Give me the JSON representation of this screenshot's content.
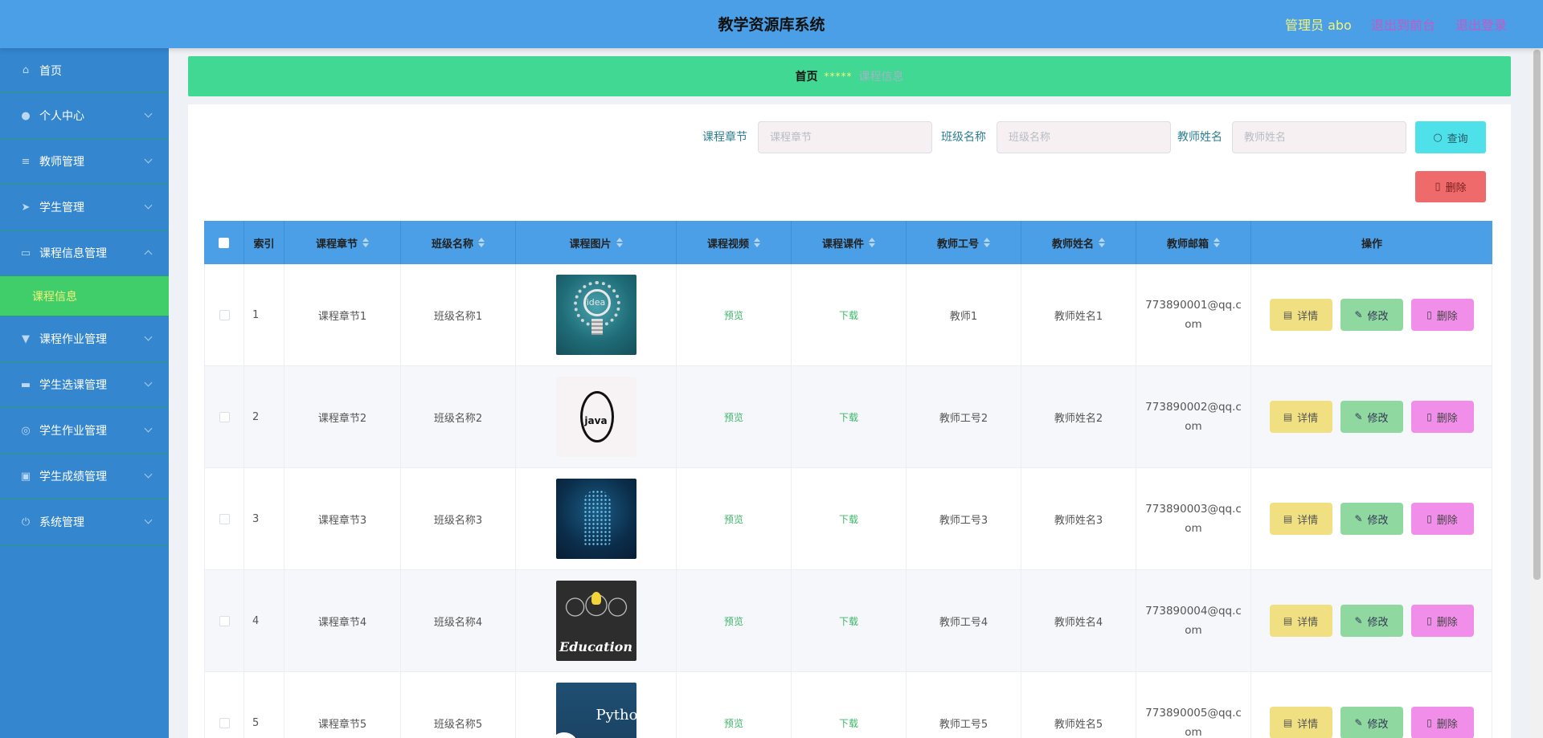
{
  "header": {
    "title": "教学资源库系统",
    "role": "管理员 abo",
    "back_label": "退出到前台",
    "logout_label": "退出登录"
  },
  "sidebar": {
    "items": [
      {
        "label": "首页",
        "icon": "home-icon"
      },
      {
        "label": "个人中心",
        "icon": "user-icon"
      },
      {
        "label": "教师管理",
        "icon": "list-icon"
      },
      {
        "label": "学生管理",
        "icon": "send-icon"
      },
      {
        "label": "课程信息管理",
        "icon": "chat-icon",
        "expanded": true
      },
      {
        "label": "课程作业管理",
        "icon": "trophy-icon"
      },
      {
        "label": "学生选课管理",
        "icon": "ticket-icon"
      },
      {
        "label": "学生作业管理",
        "icon": "help-icon"
      },
      {
        "label": "学生成绩管理",
        "icon": "briefcase-icon"
      },
      {
        "label": "系统管理",
        "icon": "power-icon"
      }
    ],
    "submenu_active": "课程信息"
  },
  "breadcrumb": {
    "home": "首页",
    "sep": "*****",
    "current": "课程信息"
  },
  "search": {
    "chapter_label": "课程章节",
    "chapter_placeholder": "课程章节",
    "class_label": "班级名称",
    "class_placeholder": "班级名称",
    "teacher_label": "教师姓名",
    "teacher_placeholder": "教师姓名",
    "query_label": "查询",
    "delete_label": "删除"
  },
  "table": {
    "columns": [
      "索引",
      "课程章节",
      "班级名称",
      "课程图片",
      "课程视频",
      "课程课件",
      "教师工号",
      "教师姓名",
      "教师邮箱",
      "操作"
    ],
    "preview_label": "预览",
    "download_label": "下载",
    "detail_label": "详情",
    "edit_label": "修改",
    "delete_label": "删除",
    "rows": [
      {
        "index": "1",
        "chapter": "课程章节1",
        "class": "班级名称1",
        "image": "idea",
        "teacher_id": "教师1",
        "teacher_name": "教师姓名1",
        "email": "773890001@qq.com"
      },
      {
        "index": "2",
        "chapter": "课程章节2",
        "class": "班级名称2",
        "image": "java",
        "teacher_id": "教师工号2",
        "teacher_name": "教师姓名2",
        "email": "773890002@qq.com"
      },
      {
        "index": "3",
        "chapter": "课程章节3",
        "class": "班级名称3",
        "image": "ai",
        "teacher_id": "教师工号3",
        "teacher_name": "教师姓名3",
        "email": "773890003@qq.com"
      },
      {
        "index": "4",
        "chapter": "课程章节4",
        "class": "班级名称4",
        "image": "education",
        "teacher_id": "教师工号4",
        "teacher_name": "教师姓名4",
        "email": "773890004@qq.com"
      },
      {
        "index": "5",
        "chapter": "课程章节5",
        "class": "班级名称5",
        "image": "python",
        "teacher_id": "教师工号5",
        "teacher_name": "教师姓名5",
        "email": "773890005@qq.com"
      }
    ],
    "image_text": {
      "idea": "idea",
      "java": "java",
      "education": "Education",
      "python": "Python"
    }
  },
  "colors": {
    "header_bg": "#4a9fe6",
    "sidebar_bg": "#3487cf",
    "breadcrumb_bg": "#41d894",
    "accent_yellow": "#f3f37a",
    "query_btn": "#4fe1ea",
    "delete_btn": "#ef6b6b"
  }
}
